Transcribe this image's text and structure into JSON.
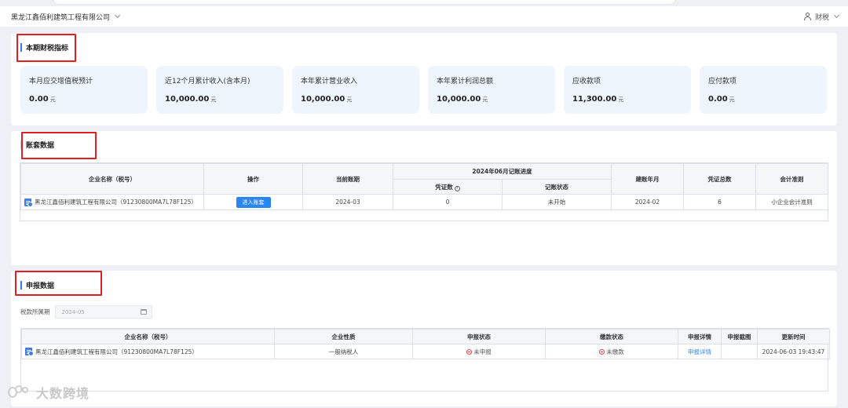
{
  "header": {
    "company": "黑龙江鑫佰利建筑工程有限公司",
    "user": "财税"
  },
  "indicators": {
    "title": "本期财税指标",
    "cards": [
      {
        "label": "本月应交增值税预计",
        "value": "0.00",
        "unit": "元"
      },
      {
        "label": "近12个月累计收入(含本月)",
        "value": "10,000.00",
        "unit": "元"
      },
      {
        "label": "本年累计营业收入",
        "value": "10,000.00",
        "unit": "元"
      },
      {
        "label": "本年累计利润总额",
        "value": "10,000.00",
        "unit": "元"
      },
      {
        "label": "应收款项",
        "value": "11,300.00",
        "unit": "元"
      },
      {
        "label": "应付款项",
        "value": "0.00",
        "unit": "元"
      }
    ]
  },
  "ledger": {
    "title": "账套数据",
    "columns": {
      "company": "企业名称（税号）",
      "action": "操作",
      "current_period": "当前账期",
      "progress_group": "2024年06月记账进度",
      "voucher_count": "凭证数",
      "booking_status": "记账状态",
      "setup_month": "建账年月",
      "voucher_total": "凭证总数",
      "standard": "会计准则"
    },
    "row": {
      "company": "黑龙江鑫佰利建筑工程有限公司（91230800MA7L78F125）",
      "action": "进入账套",
      "current_period": "2024-03",
      "voucher_count": "0",
      "booking_status": "未开始",
      "setup_month": "2024-02",
      "voucher_total": "6",
      "standard": "小企业会计准则"
    }
  },
  "declare": {
    "title": "申报数据",
    "period_label": "税款所属期",
    "period_value": "2024-05",
    "columns": {
      "company": "企业名称（税号）",
      "nature": "企业性质",
      "declare_status": "申报状态",
      "payment_status": "缴款状态",
      "detail": "申报详情",
      "screenshot": "申报截图",
      "updated": "更新时间"
    },
    "row": {
      "company": "黑龙江鑫佰利建筑工程有限公司（91230800MA7L78F125）",
      "nature": "一般纳税人",
      "declare_status": "未申报",
      "payment_status": "未缴款",
      "detail": "申报详情",
      "screenshot": "",
      "updated": "2024-06-03 19:43:47"
    }
  },
  "watermark": "大数跨境",
  "colors": {
    "accent": "#2a86f2",
    "highlight_box": "#e02020",
    "stat_bg": "#eef5fd",
    "negative": "#e04040"
  }
}
